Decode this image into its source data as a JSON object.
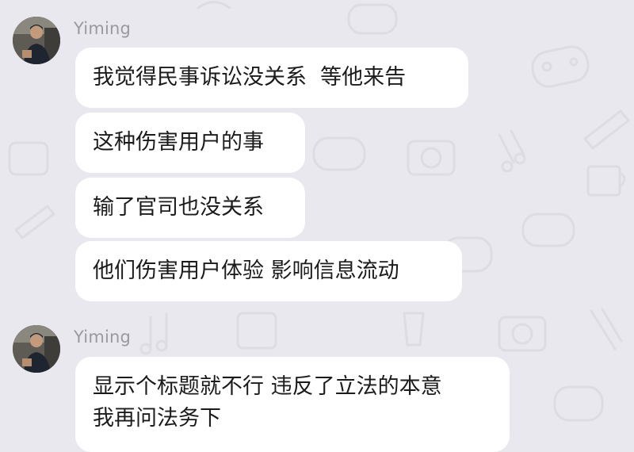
{
  "theme": {
    "background": "#e9e8ee",
    "bubble_background": "#ffffff",
    "sender_color": "#9a99a0",
    "text_color": "#1b1b1b"
  },
  "groups": [
    {
      "sender": "Yiming",
      "avatar_icon": "user-avatar-photo",
      "messages": [
        {
          "text": "我觉得民事诉讼没关系  等他来告"
        },
        {
          "text": "这种伤害用户的事"
        },
        {
          "text": "输了官司也没关系"
        },
        {
          "text": "他们伤害用户体验 影响信息流动"
        }
      ]
    },
    {
      "sender": "Yiming",
      "avatar_icon": "user-avatar-photo",
      "messages": [
        {
          "text": "显示个标题就不行 违反了立法的本意\n我再问法务下"
        }
      ]
    }
  ]
}
